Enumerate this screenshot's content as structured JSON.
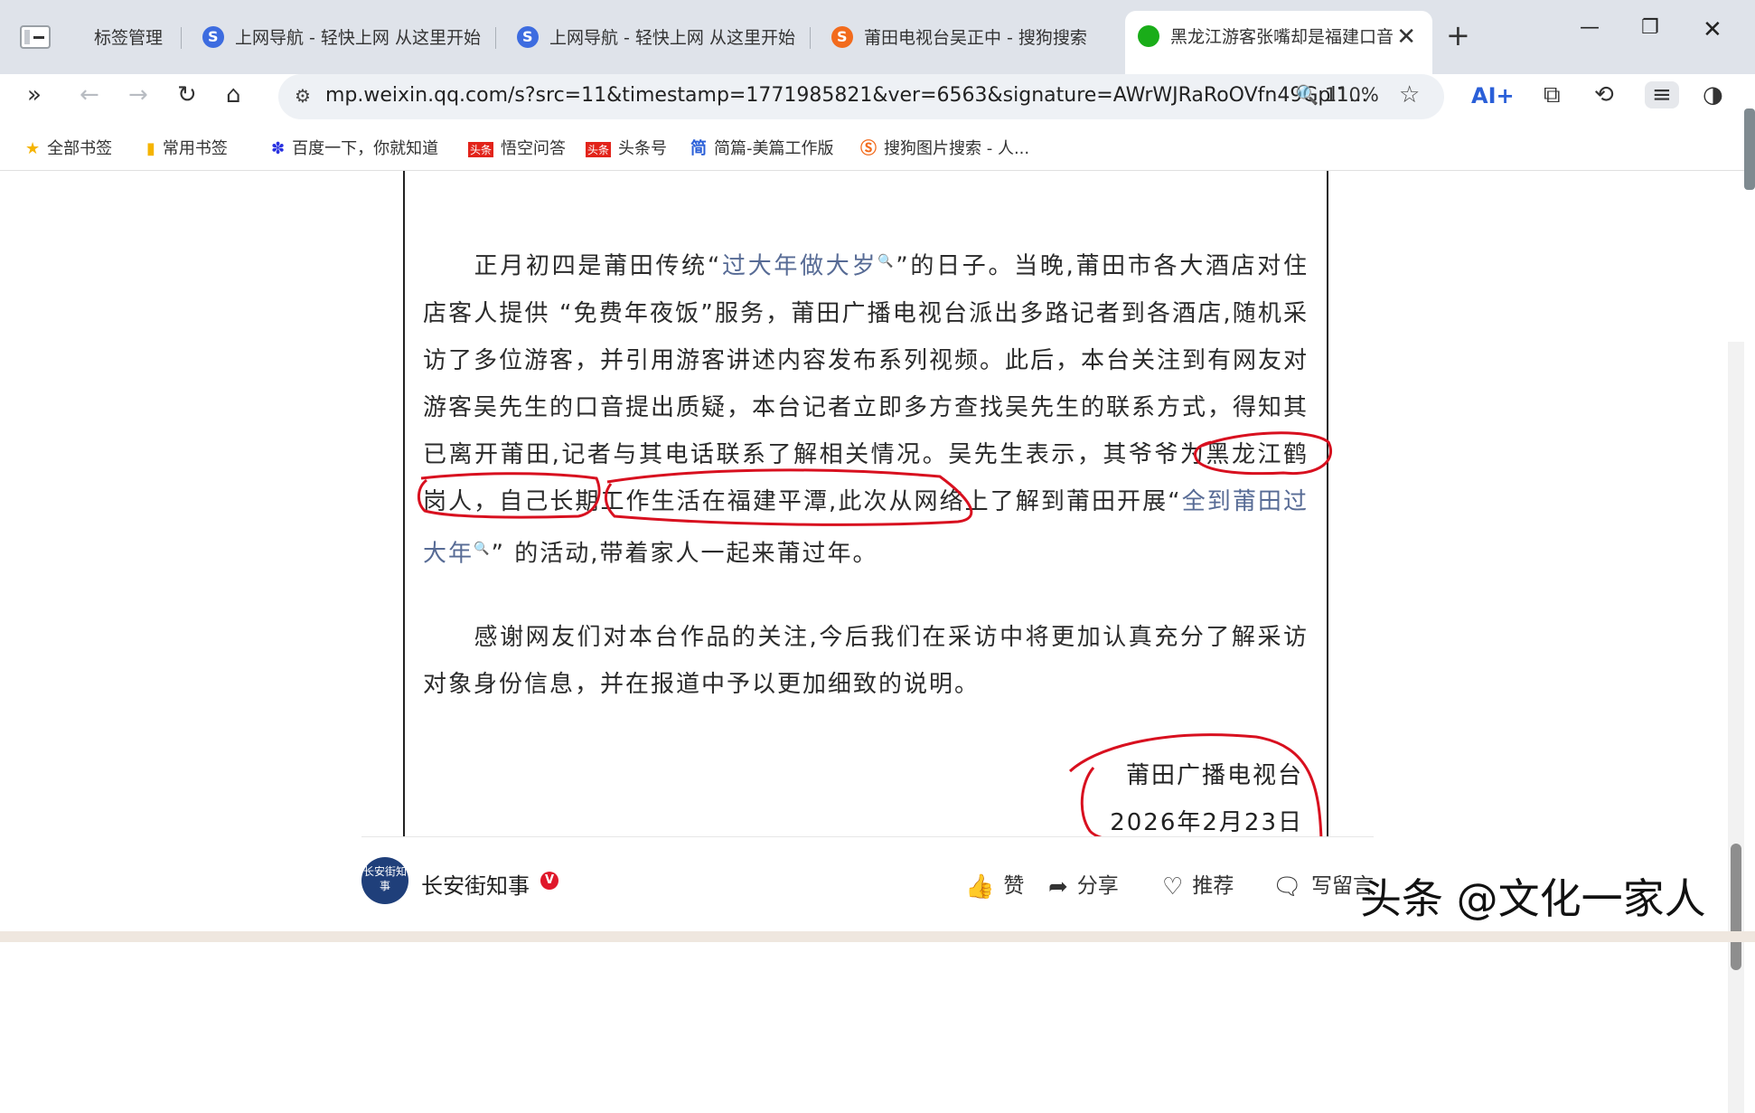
{
  "tabs": [
    {
      "label": "标签管理"
    },
    {
      "label": "上网导航 - 轻快上网 从这里开始"
    },
    {
      "label": "上网导航 - 轻快上网 从这里开始"
    },
    {
      "label": "莆田电视台吴正中 - 搜狗搜索"
    },
    {
      "label": "黑龙江游客张嘴却是福建口音"
    }
  ],
  "toolbar": {
    "url": "mp.weixin.qq.com/s?src=11&timestamp=1771985821&ver=6563&signature=AWrWJRaRoOVfn49Gpl1...",
    "zoom": "110%",
    "ai_label": "AI+"
  },
  "bookmarks": [
    {
      "label": "全部书签",
      "icon": "star-icon"
    },
    {
      "label": "常用书签",
      "icon": "bookmark-icon"
    },
    {
      "label": "百度一下，你就知道",
      "icon": "baidu-icon"
    },
    {
      "label": "悟空问答",
      "icon": "toutiao-icon"
    },
    {
      "label": "头条号",
      "icon": "toutiao-icon"
    },
    {
      "label": "简篇-美篇工作版",
      "icon": "jianpian-icon"
    },
    {
      "label": "搜狗图片搜索 - 人...",
      "icon": "sogou-icon"
    }
  ],
  "article": {
    "para1": {
      "a": "正月初四是莆田传统“",
      "link": "过大年做大岁",
      "b": "”的日子。当晚,莆田市各大酒店对住店客人提供 “免费年夜饭”服务，莆田广播电视台派出多路记者到各酒店,随机采访了多位游客，并引用游客讲述内容发布系列视频。此后，本台关注到有网友对游客吴先生的口音提出质疑，本台记者立即多方查找吴先生的联系方式，得知其已离开莆田,记者与其电话联系了解相关情况。吴先生表示，",
      "c": "其爷爷为黑龙江鹤岗人",
      "d": "，",
      "e": "自己长期工作生活在福建平潭",
      "f": ",此次从网络上了解到莆田开展“",
      "link2": "全到莆田过大年",
      "g": "” 的活动,带着家人一起来莆过年。"
    },
    "para2": "感谢网友们对本台作品的关注,今后我们在采访中将更加认真充分了解采访对象身份信息，并在报道中予以更加细致的说明。",
    "signature_org": "莆田广播电视台",
    "signature_date": "2026年2月23日"
  },
  "bottom": {
    "account": "长安街知事",
    "avatar_text": "长安街知事",
    "verified": "V",
    "like": "赞",
    "share": "分享",
    "recommend": "推荐",
    "comment": "写留言"
  },
  "watermark": "头条 @文化一家人",
  "colors": {
    "link": "#576b95",
    "annotation": "#d8101f",
    "tabstrip": "#dfe3ea"
  }
}
